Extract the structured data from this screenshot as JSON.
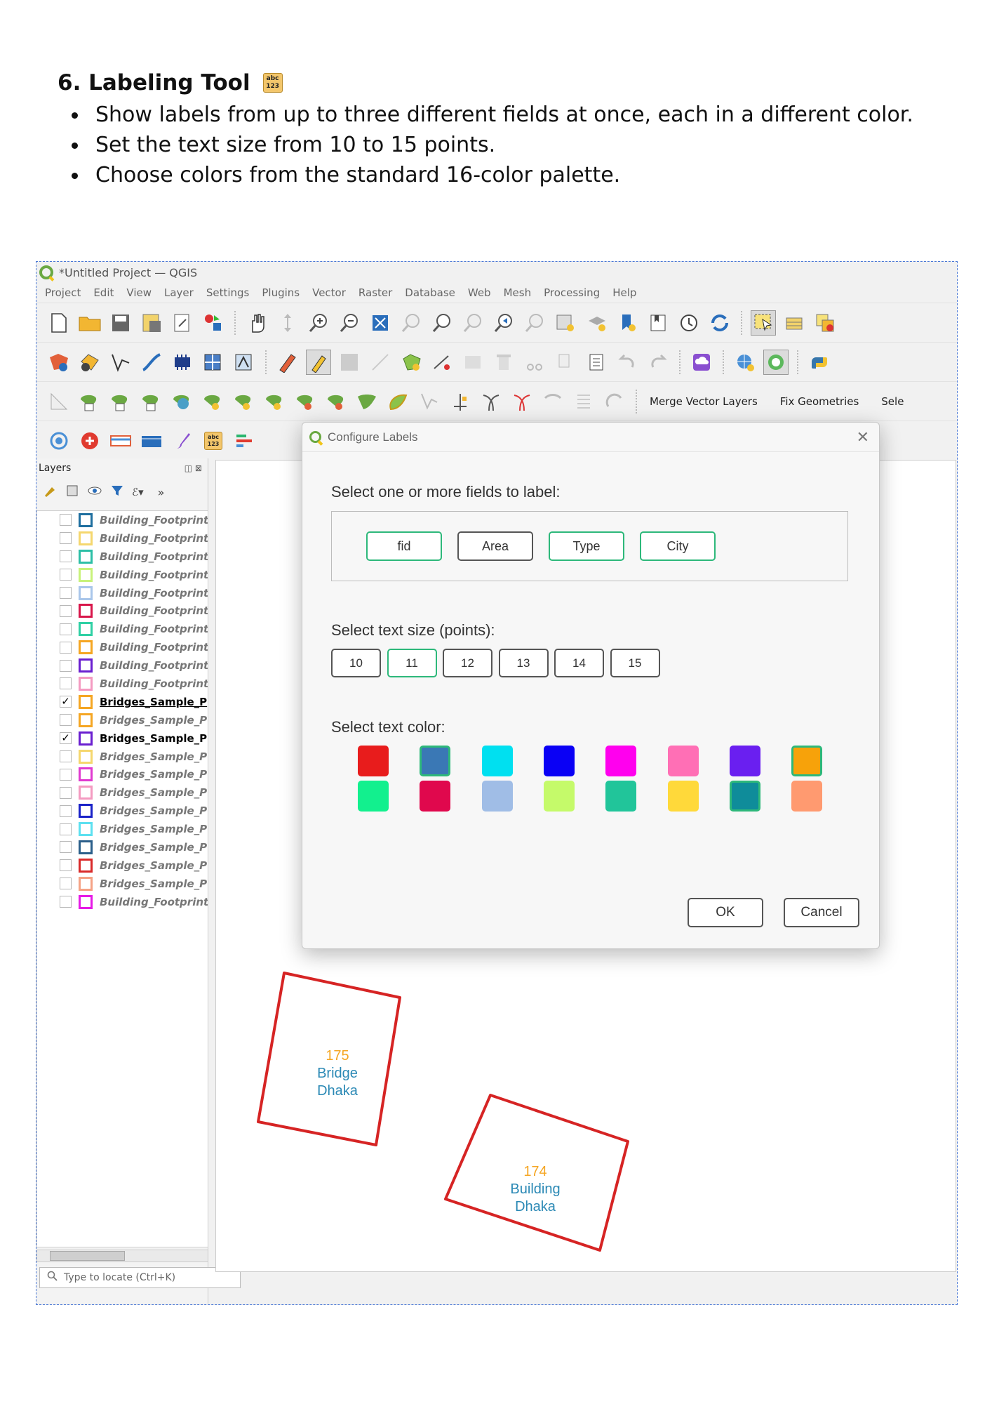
{
  "doc": {
    "heading": "6. Labeling Tool",
    "heading_icon": "abc-123-icon",
    "icon_text_top": "abc",
    "icon_text_bottom": "123",
    "bullets": [
      "Show labels from up to three different fields at once, each in a different color.",
      "Set the text size from 10 to 15 points.",
      "Choose colors from the standard 16-color palette."
    ]
  },
  "window": {
    "title": "*Untitled Project — QGIS",
    "menu": [
      "Project",
      "Edit",
      "View",
      "Layer",
      "Settings",
      "Plugins",
      "Vector",
      "Raster",
      "Database",
      "Web",
      "Mesh",
      "Processing",
      "Help"
    ],
    "toolbar_text": [
      "Merge Vector Layers",
      "Fix Geometries",
      "Sele"
    ]
  },
  "layers_panel": {
    "title": "Layers",
    "locate_placeholder": "Type to locate (Ctrl+K)",
    "layers": [
      {
        "name": "Building_Footprint",
        "checked": false,
        "color": "#1f6f9f"
      },
      {
        "name": "Building_Footprint",
        "checked": false,
        "color": "#f5d76e"
      },
      {
        "name": "Building_Footprint",
        "checked": false,
        "color": "#2dbfa6"
      },
      {
        "name": "Building_Footprint",
        "checked": false,
        "color": "#c8f27a"
      },
      {
        "name": "Building_Footprint",
        "checked": false,
        "color": "#a9c6ea"
      },
      {
        "name": "Building_Footprint",
        "checked": false,
        "color": "#d8164a"
      },
      {
        "name": "Building_Footprint",
        "checked": false,
        "color": "#2fd0a4"
      },
      {
        "name": "Building_Footprint",
        "checked": false,
        "color": "#f5a623"
      },
      {
        "name": "Building_Footprint",
        "checked": false,
        "color": "#6a1fd0"
      },
      {
        "name": "Building_Footprint",
        "checked": false,
        "color": "#f49ac1"
      },
      {
        "name": "Bridges_Sample_P",
        "checked": true,
        "color": "#f5a623"
      },
      {
        "name": "Bridges_Sample_P",
        "checked": false,
        "color": "#f5a623"
      },
      {
        "name": "Bridges_Sample_P",
        "checked": true,
        "color": "#6a1fd0"
      },
      {
        "name": "Bridges_Sample_P",
        "checked": false,
        "color": "#f5d76e"
      },
      {
        "name": "Bridges_Sample_P",
        "checked": false,
        "color": "#e03ad0"
      },
      {
        "name": "Bridges_Sample_P",
        "checked": false,
        "color": "#f49ac1"
      },
      {
        "name": "Bridges_Sample_P",
        "checked": false,
        "color": "#1a22c8"
      },
      {
        "name": "Bridges_Sample_P",
        "checked": false,
        "color": "#5ce0f0"
      },
      {
        "name": "Bridges_Sample_P",
        "checked": false,
        "color": "#2b5f8a"
      },
      {
        "name": "Bridges_Sample_P",
        "checked": false,
        "color": "#d92a2a"
      },
      {
        "name": "Bridges_Sample_P",
        "checked": false,
        "color": "#f5a285"
      },
      {
        "name": "Building_Footprint",
        "checked": false,
        "color": "#e61ae6"
      }
    ]
  },
  "map": {
    "features": [
      {
        "line1": "175",
        "line2": "Bridge",
        "line3": "Dhaka"
      },
      {
        "line1": "174",
        "line2": "Building",
        "line3": "Dhaka"
      }
    ]
  },
  "dialog": {
    "title": "Configure Labels",
    "fields_prompt": "Select one or more fields to label:",
    "fields": [
      {
        "label": "fid",
        "selected": true
      },
      {
        "label": "Area",
        "selected": false
      },
      {
        "label": "Type",
        "selected": true
      },
      {
        "label": "City",
        "selected": true
      }
    ],
    "size_prompt": "Select text size (points):",
    "sizes": [
      "10",
      "11",
      "12",
      "13",
      "14",
      "15"
    ],
    "selected_size": "11",
    "color_prompt": "Select text color:",
    "palette": [
      "#e81c1c",
      "#3a78b5",
      "#00e0f0",
      "#0a00f5",
      "#ff00ee",
      "#ff6fb5",
      "#6a1ff0",
      "#f7a20a",
      "#12f08e",
      "#e0084d",
      "#a0bde6",
      "#c5fa6a",
      "#21c59a",
      "#ffd93a",
      "#0f8c9a",
      "#ff9a70"
    ],
    "selected_colors": [
      1,
      7,
      14
    ],
    "ok_label": "OK",
    "cancel_label": "Cancel",
    "accent": "#2db87a"
  }
}
